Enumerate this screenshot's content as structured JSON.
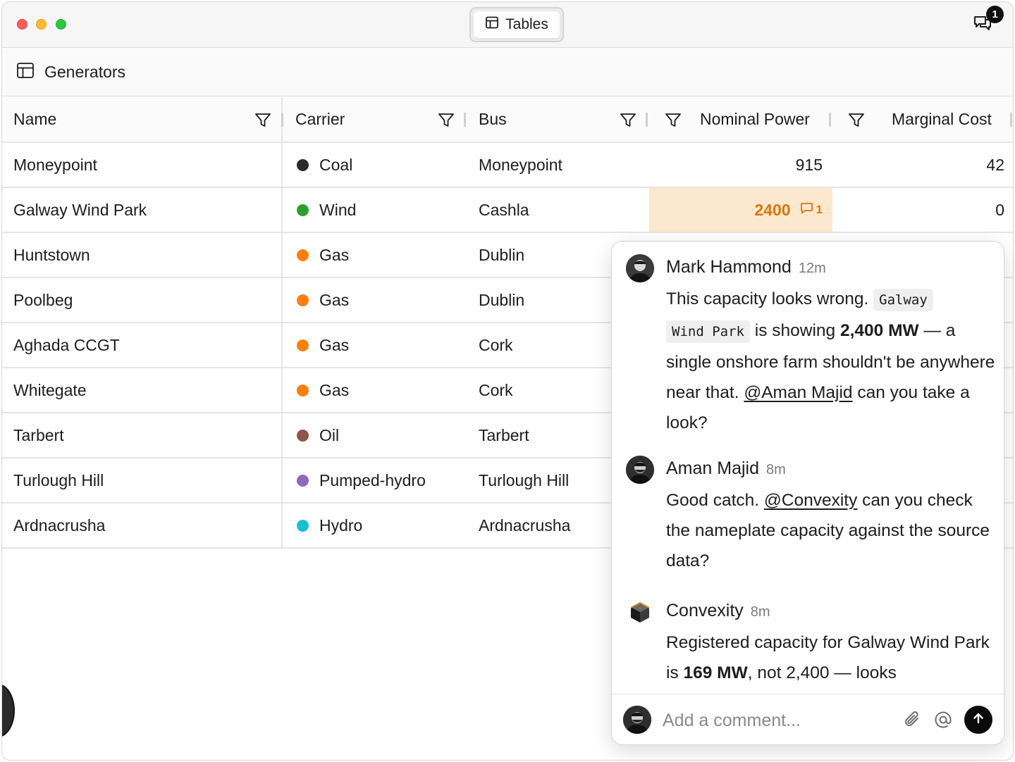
{
  "window": {
    "title": "Tables",
    "notifications_count": "1"
  },
  "subheader": {
    "title": "Generators"
  },
  "table": {
    "columns": [
      "Name",
      "Carrier",
      "Bus",
      "Nominal Power",
      "Marginal Cost"
    ],
    "rows": [
      {
        "name": "Moneypoint",
        "carrier": "Coal",
        "carrier_color": "#2b2b2b",
        "bus": "Moneypoint",
        "nominal": "915",
        "marginal": "42"
      },
      {
        "name": "Galway Wind Park",
        "carrier": "Wind",
        "carrier_color": "#2ca02c",
        "bus": "Cashla",
        "nominal": "2400",
        "marginal": "0",
        "comment_count": "1"
      },
      {
        "name": "Huntstown",
        "carrier": "Gas",
        "carrier_color": "#ff7f0e",
        "bus": "Dublin"
      },
      {
        "name": "Poolbeg",
        "carrier": "Gas",
        "carrier_color": "#ff7f0e",
        "bus": "Dublin"
      },
      {
        "name": "Aghada CCGT",
        "carrier": "Gas",
        "carrier_color": "#ff7f0e",
        "bus": "Cork"
      },
      {
        "name": "Whitegate",
        "carrier": "Gas",
        "carrier_color": "#ff7f0e",
        "bus": "Cork"
      },
      {
        "name": "Tarbert",
        "carrier": "Oil",
        "carrier_color": "#8c564b",
        "bus": "Tarbert"
      },
      {
        "name": "Turlough Hill",
        "carrier": "Pumped-hydro",
        "carrier_color": "#9467bd",
        "bus": "Turlough Hill"
      },
      {
        "name": "Ardnacrusha",
        "carrier": "Hydro",
        "carrier_color": "#17becf",
        "bus": "Ardnacrusha"
      }
    ]
  },
  "comments": [
    {
      "author": "Mark Hammond",
      "time": "12m",
      "t1": "This capacity looks wrong. ",
      "code1": "Galway",
      "code2": "Wind Park",
      "t2": " is showing ",
      "b1": "2,400 MW",
      "t3": " — a single onshore farm shouldn't be anywhere near that. ",
      "mention": "@Aman Majid",
      "t4": " can you take a look?"
    },
    {
      "author": "Aman Majid",
      "time": "8m",
      "t1": "Good catch. ",
      "mention": "@Convexity",
      "t2": " can you check the nameplate capacity against the source data?"
    },
    {
      "author": "Convexity",
      "time": "8m",
      "t1": "Registered capacity for Galway Wind Park is ",
      "b1": "169 MW",
      "t2": ", not 2,400 — looks"
    }
  ],
  "composer": {
    "placeholder": "Add a comment..."
  }
}
